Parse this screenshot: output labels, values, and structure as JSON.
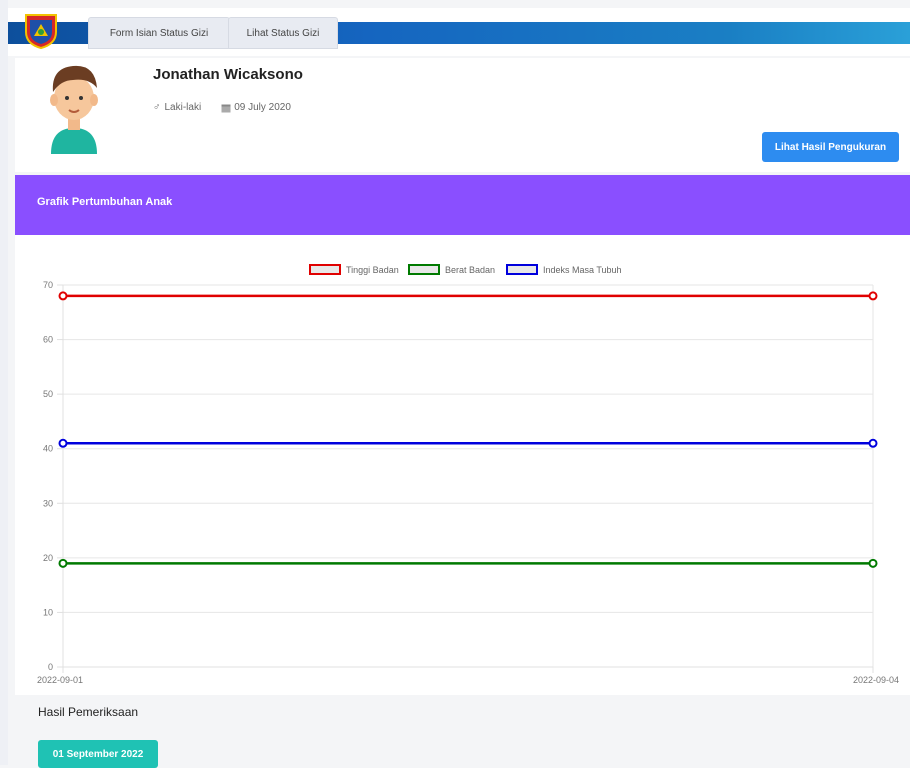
{
  "nav": {
    "tabs": [
      {
        "label": "Form Isian Status Gizi"
      },
      {
        "label": "Lihat Status Gizi"
      }
    ]
  },
  "profile": {
    "name": "Jonathan Wicaksono",
    "gender": "Laki-laki",
    "dob": "09 July 2020",
    "button_label": "Lihat Hasil Pengukuran"
  },
  "chart_section": {
    "title": "Grafik Pertumbuhan Anak"
  },
  "results": {
    "title": "Hasil Pemeriksaan",
    "dates": [
      "01 September 2022"
    ]
  },
  "colors": {
    "primary_button": "#2d8cf0",
    "header_purple": "#8a4fff",
    "date_button": "#1fc2b4",
    "series_tinggi": "#e00000",
    "series_berat": "#007a00",
    "series_imt": "#0000dd"
  },
  "chart_data": {
    "type": "line",
    "x": [
      "2022-09-01",
      "2022-09-04"
    ],
    "series": [
      {
        "name": "Tinggi Badan",
        "values": [
          68,
          68
        ],
        "color": "#e00000"
      },
      {
        "name": "Berat Badan",
        "values": [
          19,
          19
        ],
        "color": "#007a00"
      },
      {
        "name": "Indeks Masa Tubuh",
        "values": [
          41,
          41
        ],
        "color": "#0000dd"
      }
    ],
    "ylim": [
      0,
      70
    ],
    "yticks": [
      0,
      10,
      20,
      30,
      40,
      50,
      60,
      70
    ],
    "grid": true,
    "legend": "top-center"
  }
}
